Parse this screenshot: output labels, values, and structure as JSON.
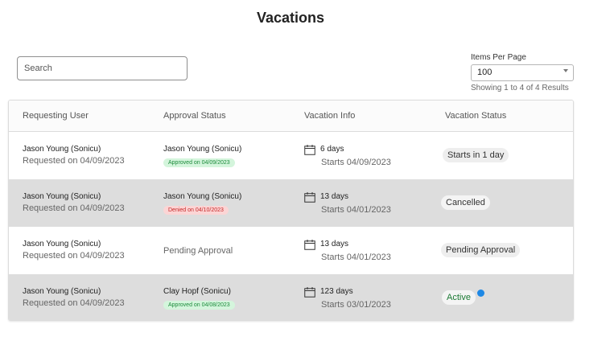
{
  "page": {
    "title": "Vacations"
  },
  "search": {
    "placeholder": "Search"
  },
  "pagination": {
    "items_per_page_label": "Items Per Page",
    "items_per_page_value": "100",
    "showing": "Showing 1 to 4 of 4 Results"
  },
  "table": {
    "headers": [
      "Requesting User",
      "Approval Status",
      "Vacation Info",
      "Vacation Status"
    ],
    "rows": [
      {
        "user": "Jason Young (Sonicu)",
        "requested": "Requested on 04/09/2023",
        "approver": "Jason Young (Sonicu)",
        "approval_badge": "Approved on 04/09/2023",
        "approval_type": "approved",
        "days": "6 days",
        "starts": "Starts 04/09/2023",
        "status": "Starts in 1 day"
      },
      {
        "user": "Jason Young (Sonicu)",
        "requested": "Requested on 04/09/2023",
        "approver": "Jason Young (Sonicu)",
        "approval_badge": "Denied on 04/10/2023",
        "approval_type": "denied",
        "days": "13 days",
        "starts": "Starts 04/01/2023",
        "status": "Cancelled"
      },
      {
        "user": "Jason Young (Sonicu)",
        "requested": "Requested on 04/09/2023",
        "approval_text": "Pending Approval",
        "approval_type": "pending",
        "days": "13 days",
        "starts": "Starts 04/01/2023",
        "status": "Pending Approval"
      },
      {
        "user": "Jason Young (Sonicu)",
        "requested": "Requested on 04/09/2023",
        "approver": "Clay Hopf (Sonicu)",
        "approval_badge": "Approved on 04/08/2023",
        "approval_type": "approved",
        "days": "123 days",
        "starts": "Starts 03/01/2023",
        "status": "Active"
      }
    ]
  },
  "colors": {
    "approved_bg": "#d4f5dc",
    "denied_bg": "#fbd5d5",
    "active_dot": "#1e88e5",
    "alt_row": "#dddddd"
  },
  "icons": {
    "vacation_info": "calendar-icon"
  }
}
